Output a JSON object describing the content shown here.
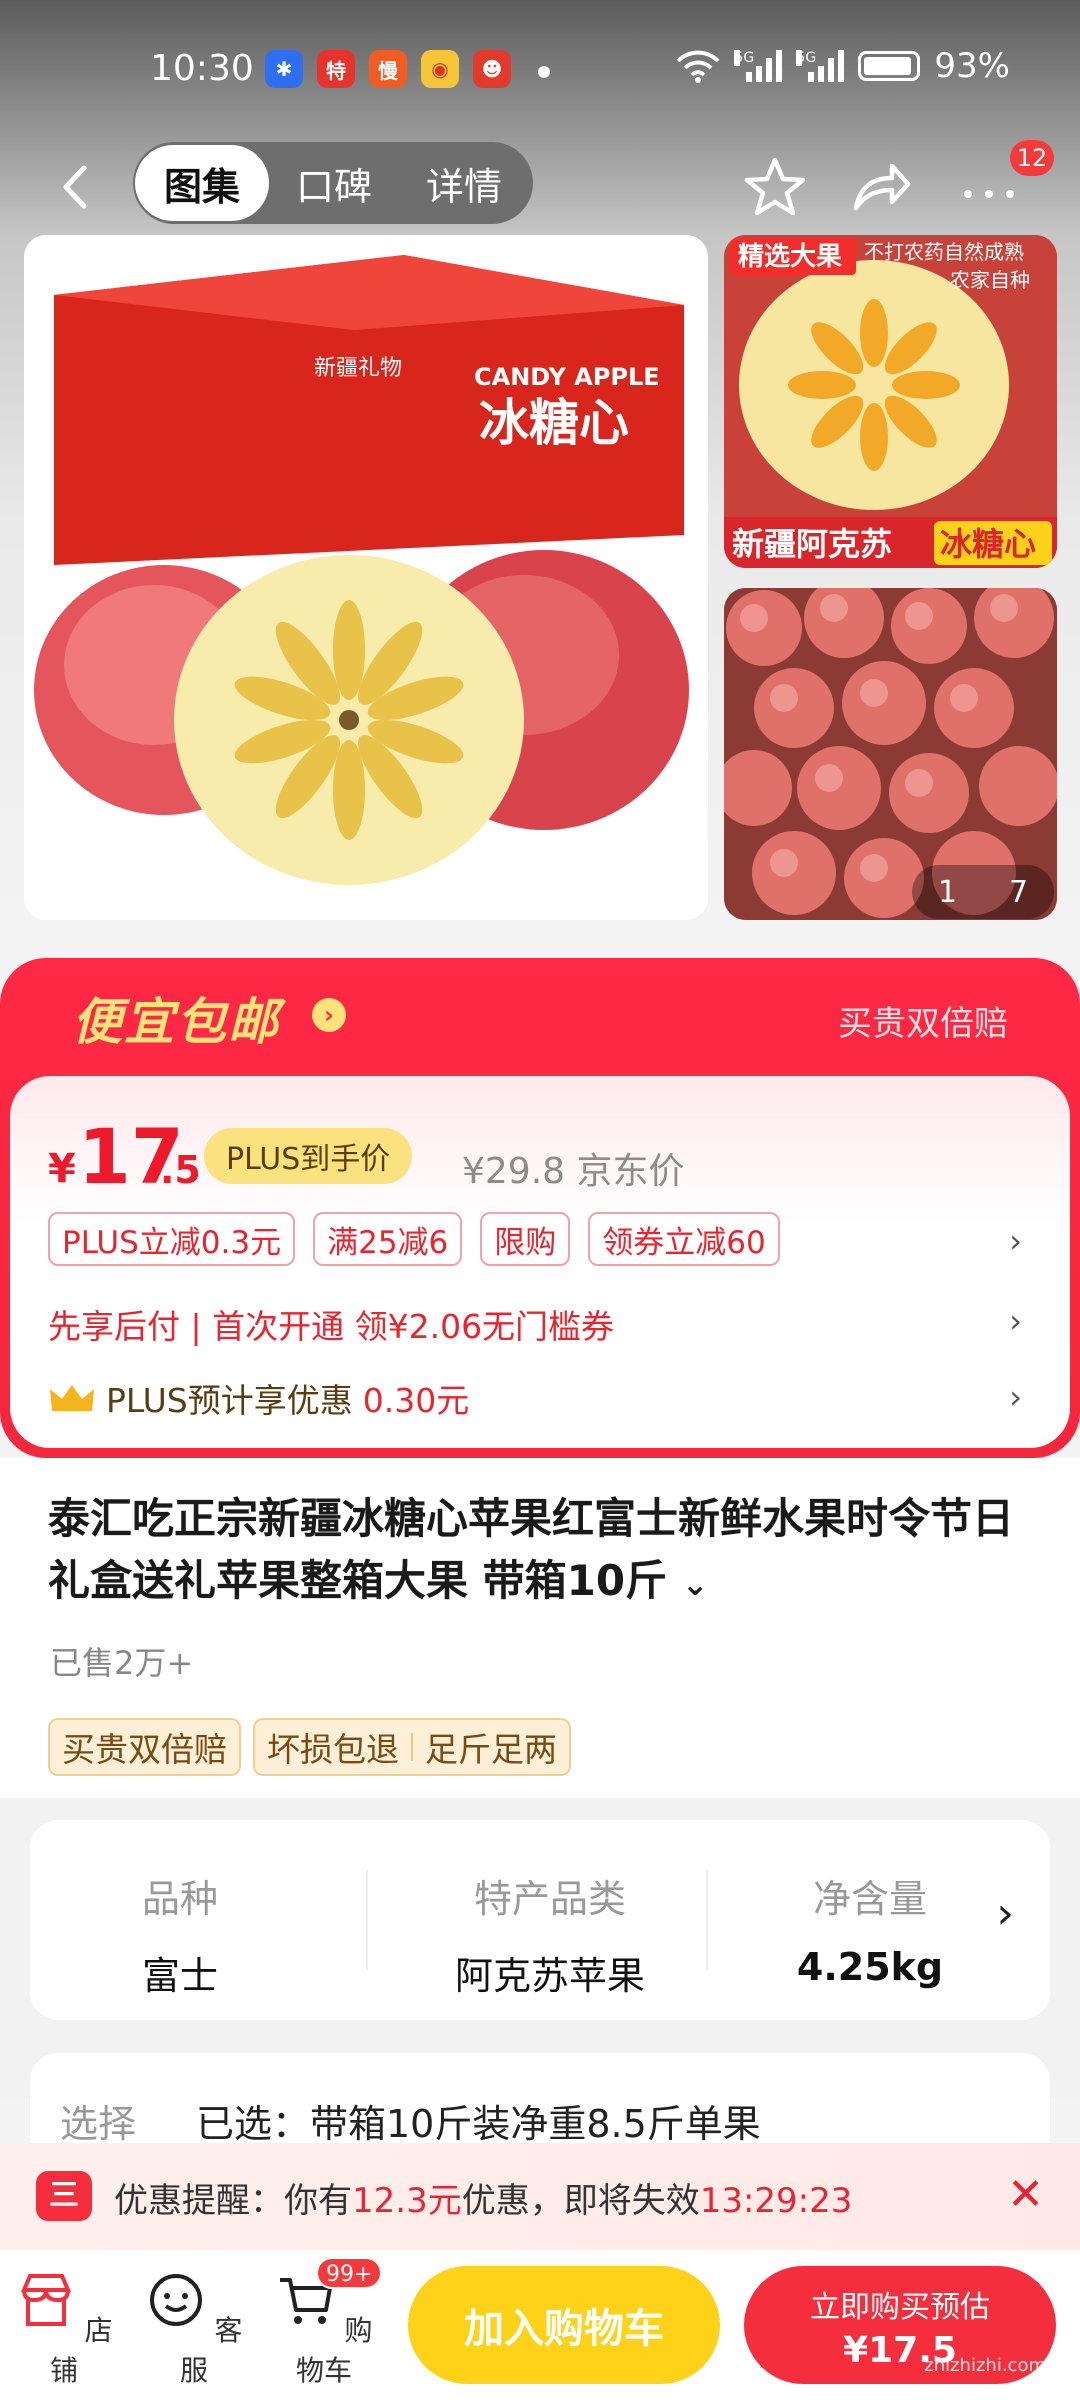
{
  "status_bar": {
    "time": "10:30",
    "battery": "93%",
    "net1": "5G",
    "net2": "5G",
    "battery_level": 0.93
  },
  "nav": {
    "tabs": [
      "图集",
      "口碑",
      "详情"
    ],
    "active_tab": 0,
    "badge": "12"
  },
  "gallery": {
    "main_img": {
      "box_brand": "新疆礼物",
      "box_en": "CANDY APPLE",
      "box_cn": "冰糖心"
    },
    "thumb1": {
      "tag": "精选大果",
      "note1": "不打农药自然成熟",
      "note2": "农家自种",
      "caption": "新疆阿克苏",
      "caption_tag": "冰糖心"
    },
    "counter": {
      "current": "1",
      "total": "7"
    }
  },
  "promo": {
    "title": "便宜包邮",
    "right": "买贵双倍赔",
    "price": {
      "currency": "¥",
      "int": "17",
      "dec": ".5",
      "tag": "PLUS到手价",
      "orig": "¥29.8",
      "orig_label": "京东价"
    },
    "tags": [
      "PLUS立减0.3元",
      "满25减6",
      "限购",
      "领券立减60"
    ],
    "paylater": "先享后付 | 首次开通 领¥2.06无门槛券",
    "plus_text": "PLUS预计享优惠",
    "plus_amount": "0.30元"
  },
  "product": {
    "title": "泰汇吃正宗新疆冰糖心苹果红富士新鲜水果时令节日礼盒送礼苹果整箱大果 带箱10斤",
    "sold": "已售2万+",
    "services": [
      "买贵双倍赔",
      "坏损包退",
      "足斤足两"
    ]
  },
  "specs": [
    {
      "k": "品种",
      "v": "富士"
    },
    {
      "k": "特产品类",
      "v": "阿克苏苹果"
    },
    {
      "k": "净含量",
      "v": "4.25kg"
    }
  ],
  "select": {
    "label": "选择",
    "value": "已选：带箱10斤装净重8.5斤单果"
  },
  "reminder": {
    "prefix": "优惠提醒：你有",
    "amount": "12.3元",
    "mid": "优惠，即将失效",
    "time": "13:29:23"
  },
  "bottom": {
    "items": [
      "店铺",
      "客服",
      "购物车"
    ],
    "cart_badge": "99+",
    "add_cart": "加入购物车",
    "buy_top": "立即购买预估",
    "buy_price": "¥17.5",
    "watermark": "zhizhizhi.com"
  },
  "colors": {
    "accent": "#f52e3e",
    "gold": "#ffd21a"
  }
}
